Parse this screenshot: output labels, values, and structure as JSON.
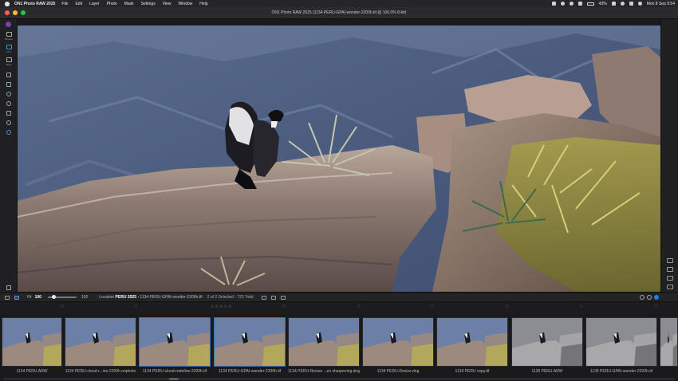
{
  "menubar": {
    "app_name": "ON1 Photo RAW 2025",
    "items": [
      "File",
      "Edit",
      "Layer",
      "Photo",
      "Mask",
      "Settings",
      "View",
      "Window",
      "Help"
    ],
    "battery": "43%",
    "datetime": "Mon 8 Sep  9:54"
  },
  "window": {
    "title": "ON1 Photo RAW 2025 (1134 PERU-GPAI-wonder-2200h.tif @ 100.0% 8-bit)"
  },
  "left_tools": [
    {
      "label": "Browse"
    },
    {
      "label": "Edit"
    },
    {
      "label": "More"
    }
  ],
  "infobar": {
    "fit_label": "Fit",
    "zoom_value": "100",
    "zoom_value_right": "100",
    "zoom_fraction": 0.2,
    "location_label": "Location",
    "location_folder": "PERU 2025",
    "location_file": "1134 PERU-GPAI-wonder-2200h.tif",
    "selection_counts": "2 of 2 Selected · 722 Total"
  },
  "filmstrip": {
    "thumbnails": [
      {
        "label": "1134 PERU.ARW",
        "variant": "color"
      },
      {
        "label": "1134 PERU-cloud-r...ine-2200h.onphoto",
        "variant": "color"
      },
      {
        "label": "1134 PERU-cloud-redefine-2200h.tif",
        "variant": "color"
      },
      {
        "label": "1134 PERU-GPAI-wonder-2200h.tif",
        "variant": "color"
      },
      {
        "label": "1134 PERU-Resize ...en sharpening.dng",
        "variant": "color"
      },
      {
        "label": "1134 PERU-Resize.dng",
        "variant": "color"
      },
      {
        "label": "1134 PERU copy.tif",
        "variant": "color"
      },
      {
        "label": "1135 PERU.ARW",
        "variant": "gray"
      },
      {
        "label": "1135 PERU-GPAI-wonder-2200h.tif",
        "variant": "gray"
      },
      {
        "label": "",
        "variant": "gray"
      }
    ]
  },
  "colors": {
    "accent": "#1e7fe0",
    "brand": "#7b3fb0",
    "selected_border": "#3d6ea8"
  }
}
